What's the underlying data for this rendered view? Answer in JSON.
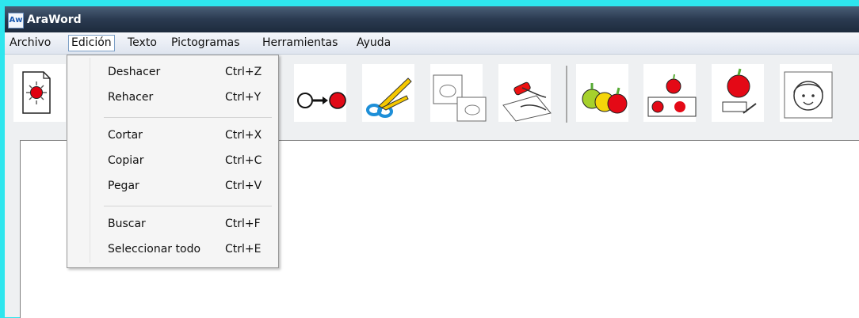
{
  "window": {
    "title": "AraWord",
    "icon_text": "Aw"
  },
  "menubar": {
    "items": [
      "Archivo",
      "Edición",
      "Texto",
      "Pictogramas",
      "Herramientas",
      "Ayuda"
    ],
    "active": "Edición"
  },
  "toolbar": {
    "buttons": [
      {
        "name": "new-document-icon"
      },
      {
        "name": "hidden-icon-1"
      },
      {
        "name": "hidden-icon-2"
      },
      {
        "name": "hidden-icon-3"
      },
      {
        "name": "move-arrow-icon"
      },
      {
        "name": "scissors-icon"
      },
      {
        "name": "copy-pictogram-icon"
      },
      {
        "name": "glue-paste-icon"
      },
      {
        "name": "apples-group-icon"
      },
      {
        "name": "pictogram-select-icon"
      },
      {
        "name": "apple-write-icon"
      },
      {
        "name": "face-icon"
      }
    ]
  },
  "edicion_menu": {
    "items": [
      {
        "label": "Deshacer",
        "shortcut": "Ctrl+Z"
      },
      {
        "label": "Rehacer",
        "shortcut": "Ctrl+Y"
      },
      {
        "label": "Cortar",
        "shortcut": "Ctrl+X"
      },
      {
        "label": "Copiar",
        "shortcut": "Ctrl+C"
      },
      {
        "label": "Pegar",
        "shortcut": "Ctrl+V"
      },
      {
        "label": "Buscar",
        "shortcut": "Ctrl+F"
      },
      {
        "label": "Seleccionar todo",
        "shortcut": "Ctrl+E"
      }
    ]
  },
  "colors": {
    "titlebar": "#2a3a50",
    "desktop": "#2ee6ee",
    "menu_highlight_border": "#7c9fc5"
  }
}
